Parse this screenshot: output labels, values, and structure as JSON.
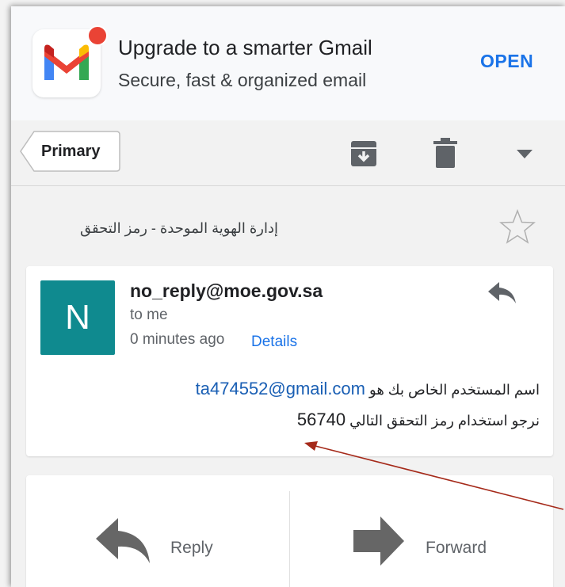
{
  "promo": {
    "title": "Upgrade to a smarter Gmail",
    "subtitle": "Secure, fast & organized email",
    "open_label": "OPEN",
    "icon": "gmail-logo-icon",
    "accent": "#1a73e8"
  },
  "toolbar": {
    "label": "Primary",
    "icons": [
      "archive-icon",
      "trash-icon",
      "more-dropdown-icon"
    ]
  },
  "email": {
    "subject": "إدارة الهوية الموحدة - رمز التحقق",
    "sender": "no_reply@moe.gov.sa",
    "avatar_letter": "N",
    "avatar_color": "#0f8a8f",
    "recipient": "to me",
    "time": "0 minutes ago",
    "details_label": "Details",
    "body_line1_text": "اسم المستخدم الخاص بك هو",
    "body_line1_email": "ta474552@gmail.com",
    "body_line2_text": "نرجو استخدام رمز التحقق التالي",
    "body_line2_code": "56740"
  },
  "actions": {
    "reply_label": "Reply",
    "forward_label": "Forward"
  },
  "annotation": {
    "color": "#a52a1a"
  }
}
